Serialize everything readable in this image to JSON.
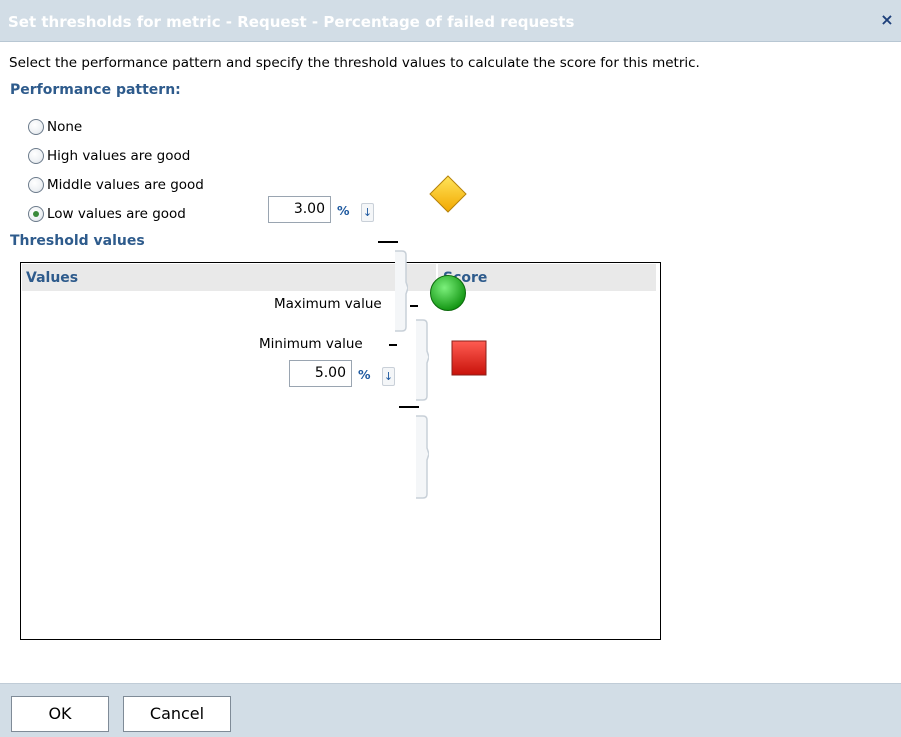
{
  "dialog": {
    "title": "Set thresholds for metric - Request - Percentage of failed requests",
    "close_glyph": "×",
    "description": "Select the performance pattern and specify the threshold values to calculate the score for this metric."
  },
  "pattern": {
    "heading": "Performance pattern:",
    "options": [
      {
        "label": "None",
        "checked": false
      },
      {
        "label": "High values are good",
        "checked": false
      },
      {
        "label": "Middle values are good",
        "checked": false
      },
      {
        "label": "Low values are good",
        "checked": true
      }
    ]
  },
  "thresholds": {
    "heading": "Threshold values",
    "col_values": "Values",
    "col_score": "Score",
    "max_label": "Maximum value",
    "min_label": "Minimum value",
    "unit": "%",
    "spin_glyph": "↓",
    "inputs": [
      "5.00",
      "3.00"
    ],
    "scores": [
      {
        "icon": "red-square-icon",
        "color": "#e8302a"
      },
      {
        "icon": "yellow-diamond-icon",
        "color": "#f7c81d"
      },
      {
        "icon": "green-circle-icon",
        "color": "#18a818"
      }
    ]
  },
  "footer": {
    "ok_label": "OK",
    "cancel_label": "Cancel"
  }
}
